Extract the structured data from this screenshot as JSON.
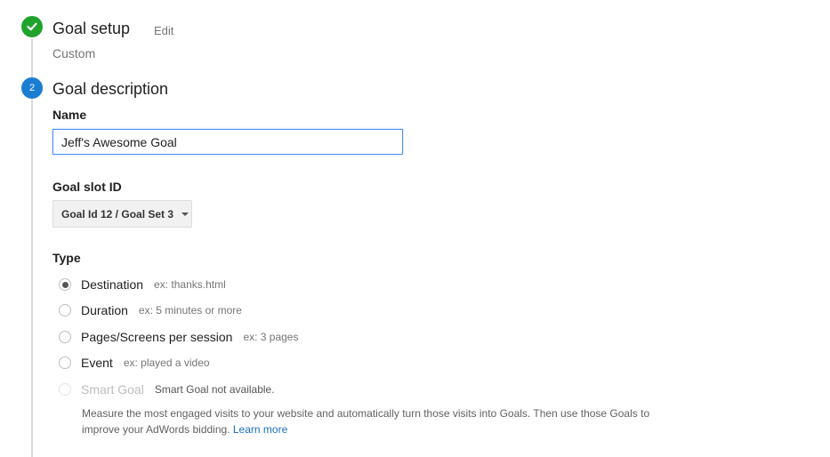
{
  "steps": {
    "setup": {
      "title": "Goal setup",
      "edit_label": "Edit",
      "summary": "Custom",
      "status": "complete",
      "color": "#1fa32c"
    },
    "description": {
      "number": "2",
      "title": "Goal description",
      "color": "#1a7dd1"
    }
  },
  "form": {
    "name": {
      "label": "Name",
      "value": "Jeff's Awesome Goal"
    },
    "slot": {
      "label": "Goal slot ID",
      "selected": "Goal Id 12 / Goal Set 3"
    },
    "type": {
      "label": "Type",
      "options": [
        {
          "label": "Destination",
          "hint": "ex: thanks.html",
          "checked": true,
          "disabled": false
        },
        {
          "label": "Duration",
          "hint": "ex: 5 minutes or more",
          "checked": false,
          "disabled": false
        },
        {
          "label": "Pages/Screens per session",
          "hint": "ex: 3 pages",
          "checked": false,
          "disabled": false
        },
        {
          "label": "Event",
          "hint": "ex: played a video",
          "checked": false,
          "disabled": false
        },
        {
          "label": "Smart Goal",
          "hint": "Smart Goal not available.",
          "checked": false,
          "disabled": true
        }
      ],
      "smart_description": "Measure the most engaged visits to your website and automatically turn those visits into Goals. Then use those Goals to improve your AdWords bidding. ",
      "learn_more": "Learn more",
      "link_color": "#1a6fc2"
    }
  }
}
